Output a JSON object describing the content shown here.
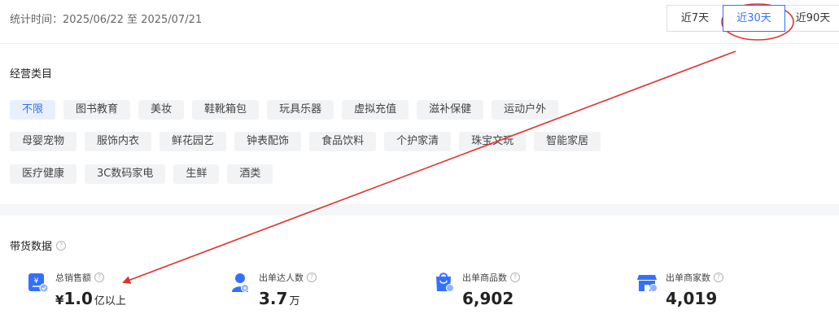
{
  "header": {
    "stat_time": "统计时间：2025/06/22 至 2025/07/21",
    "ranges": [
      {
        "label": "近7天"
      },
      {
        "label": "近30天",
        "selected": true
      },
      {
        "label": "近90天"
      }
    ]
  },
  "category": {
    "title": "经营类目",
    "rows": [
      [
        "不限",
        "图书教育",
        "美妆",
        "鞋靴箱包",
        "玩具乐器",
        "虚拟充值",
        "滋补保健",
        "运动户外"
      ],
      [
        "母婴宠物",
        "服饰内衣",
        "鲜花园艺",
        "钟表配饰",
        "食品饮料",
        "个护家清",
        "珠宝文玩",
        "智能家居"
      ],
      [
        "医疗健康",
        "3C数码家电",
        "生鲜",
        "酒类"
      ]
    ],
    "selected": "不限"
  },
  "sales_data": {
    "title": "带货数据",
    "metrics": [
      {
        "label": "总销售额",
        "prefix": "¥",
        "value": "1.0",
        "unit": "亿以上",
        "icon": "sales-amount-icon"
      },
      {
        "label": "出单达人数",
        "prefix": "",
        "value": "3.7",
        "unit": "万",
        "icon": "influencer-icon"
      },
      {
        "label": "出单商品数",
        "prefix": "",
        "value": "6,902",
        "unit": "",
        "icon": "shopping-bag-icon"
      },
      {
        "label": "出单商家数",
        "prefix": "",
        "value": "4,019",
        "unit": "",
        "icon": "store-icon"
      }
    ]
  },
  "colors": {
    "accent": "#3370ff",
    "annotation": "#e0322b",
    "tag_bg": "#f2f3f5"
  }
}
